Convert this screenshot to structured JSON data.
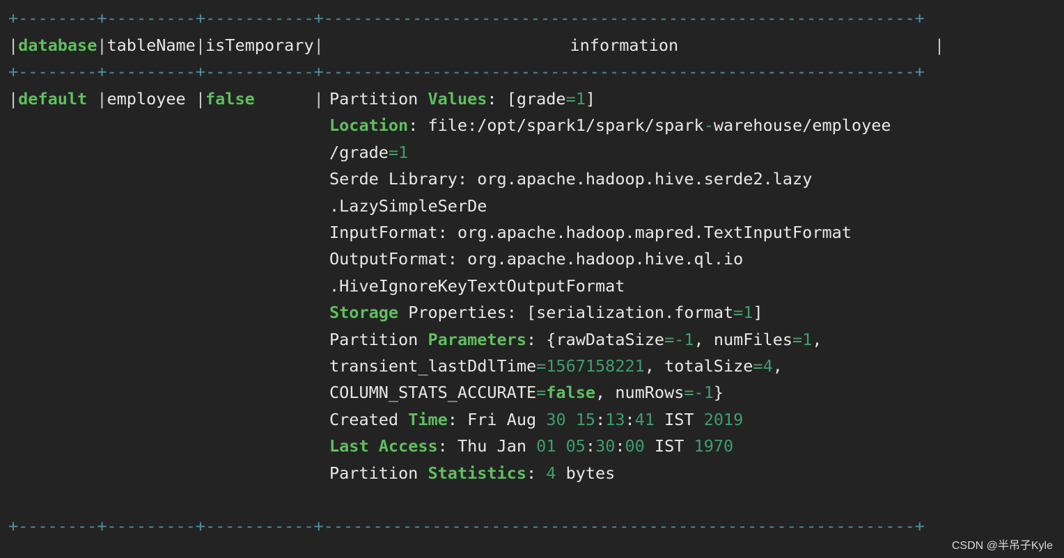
{
  "table": {
    "border_line": "+--------+---------+-----------+------------------------------------------------------------+",
    "headers": [
      "database",
      "tableName",
      "isTemporary",
      "information"
    ],
    "row": {
      "database": "default",
      "tableName": "employee",
      "isTemporary": "false",
      "information": [
        "Partition Values: [grade=1]",
        "Location: file:/opt/spark1/spark/spark-warehouse/employee",
        "/grade=1",
        "Serde Library: org.apache.hadoop.hive.serde2.lazy",
        ".LazySimpleSerDe",
        "InputFormat: org.apache.hadoop.mapred.TextInputFormat",
        "OutputFormat: org.apache.hadoop.hive.ql.io",
        ".HiveIgnoreKeyTextOutputFormat",
        "Storage Properties: [serialization.format=1]",
        "Partition Parameters: {rawDataSize=-1, numFiles=1,",
        "transient_lastDdlTime=1567158221, totalSize=4,",
        "COLUMN_STATS_ACCURATE=false, numRows=-1}",
        "Created Time: Fri Aug 30 15:13:41 IST 2019",
        "Last Access: Thu Jan 01 05:30:00 IST 1970",
        "Partition Statistics: 4 bytes"
      ]
    }
  },
  "watermark": "CSDN @半吊子Kyle",
  "colors": {
    "background": "#232323",
    "border": "#4e8fa3",
    "keyword": "#5fbf5f",
    "number": "#3e9e6e",
    "text": "#e8e8e8"
  }
}
